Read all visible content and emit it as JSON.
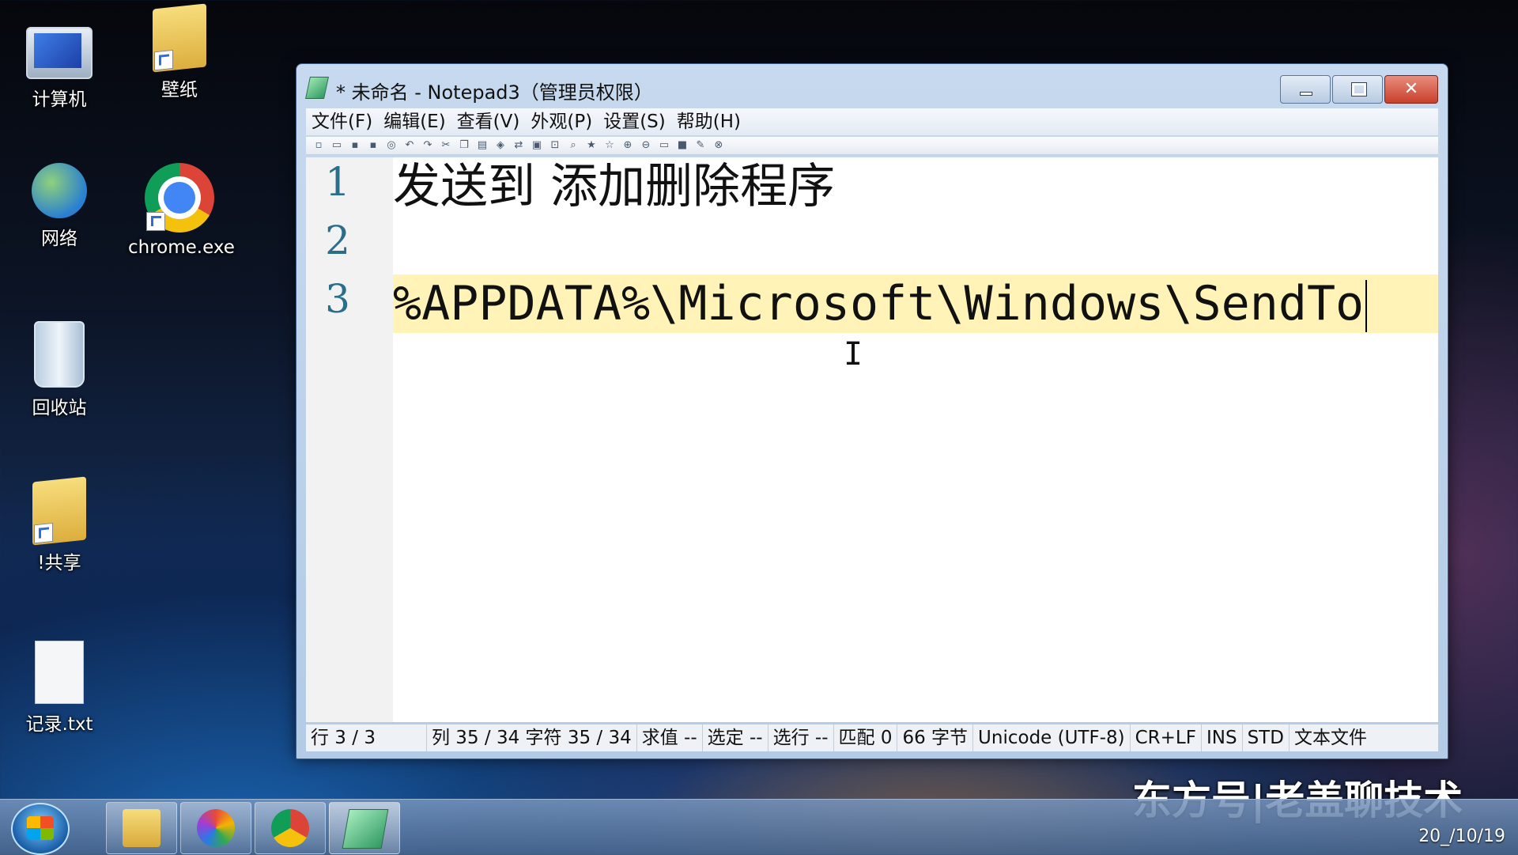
{
  "desktop": {
    "icons": [
      {
        "label": "计算机"
      },
      {
        "label": "壁纸"
      },
      {
        "label": "网络"
      },
      {
        "label": "chrome.exe"
      },
      {
        "label": "回收站"
      },
      {
        "label": "!共享"
      },
      {
        "label": "记录.txt"
      }
    ]
  },
  "window": {
    "title": "* 未命名 - Notepad3（管理员权限）",
    "close_symbol": "✕",
    "menu": [
      "文件(F)",
      "编辑(E)",
      "查看(V)",
      "外观(P)",
      "设置(S)",
      "帮助(H)"
    ],
    "toolbar_icons": [
      "new-icon",
      "open-icon",
      "save-icon",
      "save-as-icon",
      "revert-icon",
      "undo-icon",
      "redo-icon",
      "cut-icon",
      "copy-icon",
      "paste-icon",
      "find-icon",
      "replace-icon",
      "wordwrap-icon",
      "zoom-icon",
      "find-next-icon",
      "favorite-icon",
      "add-favorite-icon",
      "zoom-in-icon",
      "zoom-out-icon",
      "view-icon",
      "screen-icon",
      "pin-icon",
      "exit-icon"
    ],
    "editor": {
      "lines": [
        {
          "number": "1",
          "text": "发送到 添加删除程序"
        },
        {
          "number": "2",
          "text": ""
        },
        {
          "number": "3",
          "text": "%APPDATA%\\Microsoft\\Windows\\SendTo"
        }
      ],
      "current_line": 3
    },
    "statusbar": [
      "行 3 / 3",
      "列 35 / 34 字符 35 / 34",
      "求值 --",
      "选定 --",
      "选行 --",
      "匹配 0",
      "66 字节",
      "Unicode (UTF-8)",
      "CR+LF",
      "INS",
      "STD",
      "文本文件"
    ]
  },
  "taskbar": {
    "apps": [
      "file-explorer-icon",
      "color-app-icon",
      "chrome-icon",
      "notepad3-icon"
    ],
    "tray_date": "20_/10/19"
  },
  "watermark": "东方号|老盖聊技术"
}
